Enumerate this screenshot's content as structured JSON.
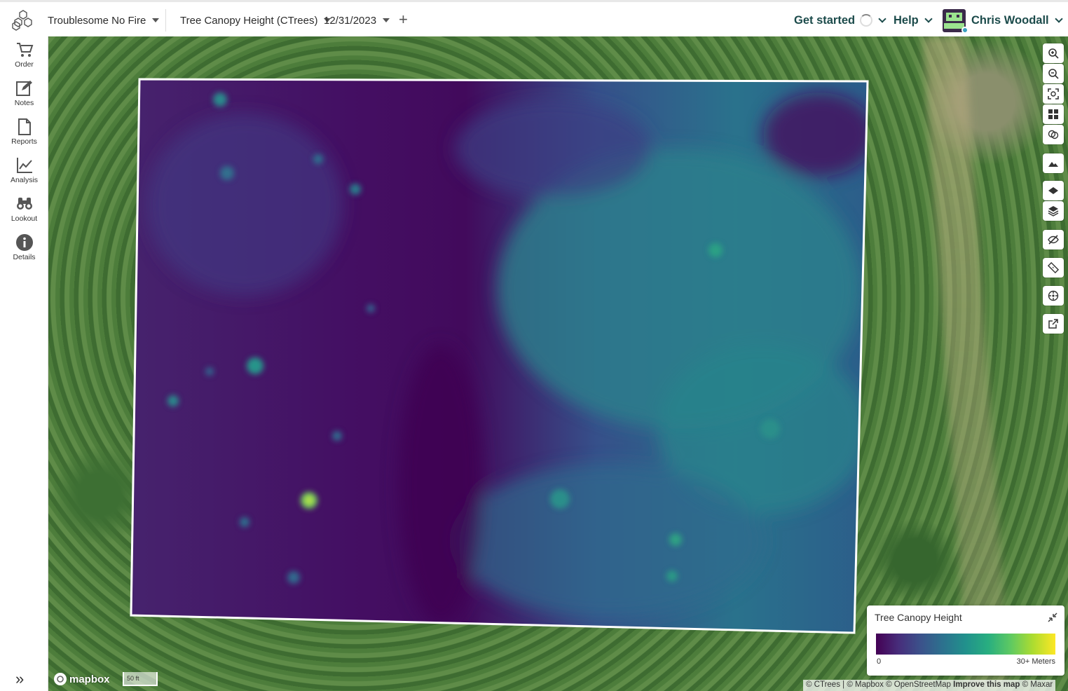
{
  "header": {
    "project": "Troublesome No Fire",
    "layer": "Tree Canopy Height (CTrees)",
    "date": "12/31/2023",
    "add_icon": "plus-icon",
    "get_started": "Get started",
    "help": "Help",
    "user_name": "Chris Woodall"
  },
  "sidebar": {
    "items": [
      {
        "label": "Order",
        "icon": "cart-icon"
      },
      {
        "label": "Notes",
        "icon": "notes-icon"
      },
      {
        "label": "Reports",
        "icon": "report-icon"
      },
      {
        "label": "Analysis",
        "icon": "analysis-icon"
      },
      {
        "label": "Lookout",
        "icon": "binoculars-icon"
      },
      {
        "label": "Details",
        "icon": "info-icon"
      }
    ],
    "collapse_icon": "double-chevron-right-icon"
  },
  "map": {
    "tools": [
      "zoom-in-icon",
      "zoom-out-icon",
      "fit-bounds-icon",
      "grid-icon",
      "layers-compare-icon",
      "terrain-icon",
      "single-layer-icon",
      "layers-icon",
      "hide-icon",
      "ruler-icon",
      "target-icon",
      "external-link-icon"
    ],
    "legend": {
      "title": "Tree Canopy Height",
      "min_label": "0",
      "max_label": "30+ Meters",
      "colors": [
        "#440154",
        "#3b528b",
        "#21918c",
        "#5ec962",
        "#fde725"
      ]
    },
    "mapbox_logo": "mapbox",
    "scale_label": "50 ft",
    "attribution": {
      "text": "© CTrees | © Mapbox © OpenStreetMap ",
      "improve": "Improve this map",
      "maxar": " © Maxar"
    }
  }
}
